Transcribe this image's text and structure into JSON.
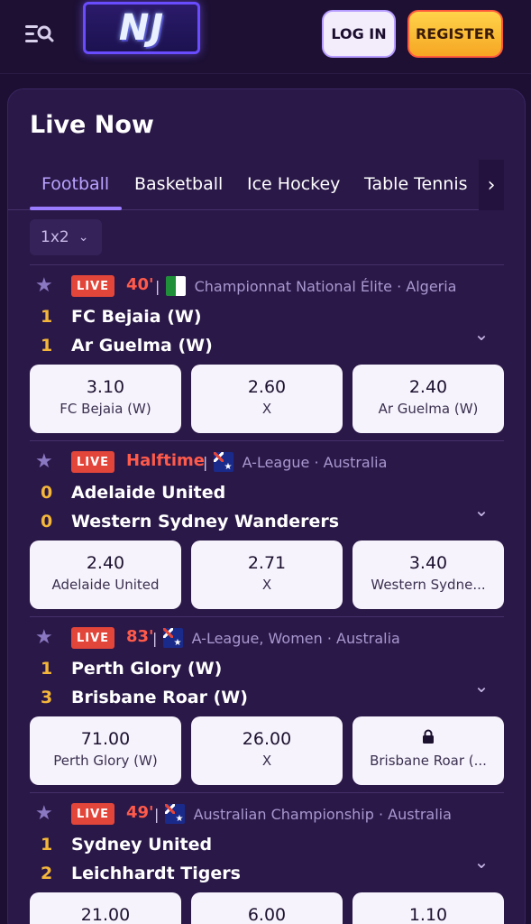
{
  "header": {
    "logo_text": "NJ",
    "login_label": "LOG IN",
    "register_label": "REGISTER"
  },
  "panel": {
    "title": "Live Now",
    "tabs": [
      {
        "label": "Football",
        "active": true
      },
      {
        "label": "Basketball",
        "active": false
      },
      {
        "label": "Ice Hockey",
        "active": false
      },
      {
        "label": "Table Tennis",
        "active": false
      }
    ],
    "market": "1x2",
    "events": [
      {
        "badge": "LIVE",
        "time": "40'",
        "league": "Championnat National Élite",
        "country": "Algeria",
        "flag": "algeria",
        "home": {
          "score": "1",
          "name": "FC Bejaia (W)"
        },
        "away": {
          "score": "1",
          "name": "Ar Guelma (W)"
        },
        "odds": [
          {
            "price": "3.10",
            "label": "FC Bejaia (W)"
          },
          {
            "price": "2.60",
            "label": "X"
          },
          {
            "price": "2.40",
            "label": "Ar Guelma (W)"
          }
        ]
      },
      {
        "badge": "LIVE",
        "time": "Halftime",
        "league": "A-League",
        "country": "Australia",
        "flag": "australia",
        "home": {
          "score": "0",
          "name": "Adelaide United"
        },
        "away": {
          "score": "0",
          "name": "Western Sydney Wanderers"
        },
        "odds": [
          {
            "price": "2.40",
            "label": "Adelaide United"
          },
          {
            "price": "2.71",
            "label": "X"
          },
          {
            "price": "3.40",
            "label": "Western Sydne..."
          }
        ]
      },
      {
        "badge": "LIVE",
        "time": "83'",
        "league": "A-League, Women",
        "country": "Australia",
        "flag": "australia",
        "home": {
          "score": "1",
          "name": "Perth Glory (W)"
        },
        "away": {
          "score": "3",
          "name": "Brisbane Roar (W)"
        },
        "odds": [
          {
            "price": "71.00",
            "label": "Perth Glory (W)"
          },
          {
            "price": "26.00",
            "label": "X"
          },
          {
            "price": "",
            "label": "Brisbane Roar (...",
            "locked": true
          }
        ]
      },
      {
        "badge": "LIVE",
        "time": "49'",
        "league": "Australian Championship",
        "country": "Australia",
        "flag": "australia",
        "home": {
          "score": "1",
          "name": "Sydney United"
        },
        "away": {
          "score": "2",
          "name": "Leichhardt Tigers"
        },
        "odds": [
          {
            "price": "21.00",
            "label": ""
          },
          {
            "price": "6.00",
            "label": ""
          },
          {
            "price": "1.10",
            "label": ""
          }
        ]
      }
    ]
  },
  "icons": {
    "menu": "menu-search-icon",
    "star": "star-icon",
    "expand": "chevron-down-icon",
    "tabs_next": "chevron-right-icon",
    "lock": "lock-icon"
  },
  "colors": {
    "background": "#1c0f33",
    "panel": "#2a1848",
    "accent": "#9a7cff",
    "live": "#e2453a",
    "score": "#f5b73a",
    "register": "#f6a623"
  }
}
